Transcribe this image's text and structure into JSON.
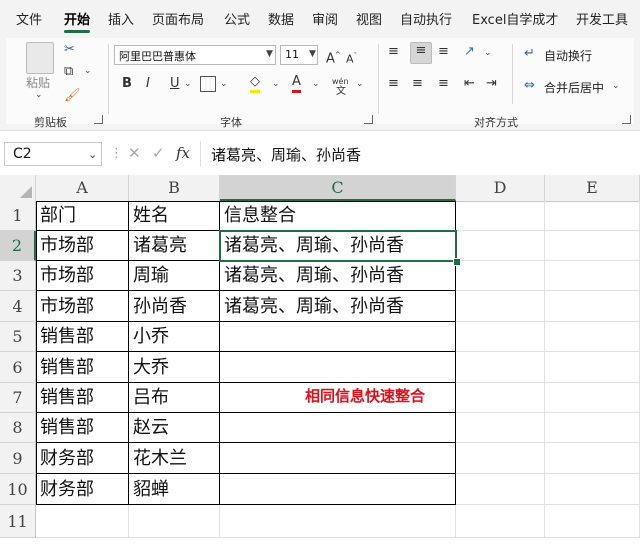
{
  "menu": [
    "文件",
    "开始",
    "插入",
    "页面布局",
    "公式",
    "数据",
    "审阅",
    "视图",
    "自动执行",
    "Excel自学成才",
    "开发工具"
  ],
  "active_menu": "开始",
  "ribbon": {
    "paste": "粘贴",
    "clipboard": "剪贴板",
    "font_name": "阿里巴巴普惠体",
    "font_size": "11",
    "font_group": "字体",
    "wrap_text": "自动换行",
    "merge_center": "合并后居中",
    "alignment_group": "对齐方式",
    "bold": "B",
    "italic": "I",
    "underline": "U",
    "phonetic": "wén"
  },
  "formula_bar": {
    "name_box": "C2",
    "fx": "fx",
    "content": "诸葛亮、周瑜、孙尚香"
  },
  "columns": [
    "A",
    "B",
    "C",
    "D",
    "E"
  ],
  "rows": [
    "1",
    "2",
    "3",
    "4",
    "5",
    "6",
    "7",
    "8",
    "9",
    "10",
    "11"
  ],
  "cells": {
    "A": [
      "部门",
      "市场部",
      "市场部",
      "市场部",
      "销售部",
      "销售部",
      "销售部",
      "销售部",
      "财务部",
      "财务部",
      ""
    ],
    "B": [
      "姓名",
      "诸葛亮",
      "周瑜",
      "孙尚香",
      "小乔",
      "大乔",
      "吕布",
      "赵云",
      "花木兰",
      "貂蝉",
      ""
    ],
    "C": [
      "信息整合",
      "诸葛亮、周瑜、孙尚香",
      "诸葛亮、周瑜、孙尚香",
      "诸葛亮、周瑜、孙尚香",
      "",
      "",
      "",
      "",
      "",
      "",
      ""
    ]
  },
  "annotation": "相同信息快速整合",
  "colors": {
    "accent": "#1f6e43",
    "annotation": "#e0101a"
  }
}
